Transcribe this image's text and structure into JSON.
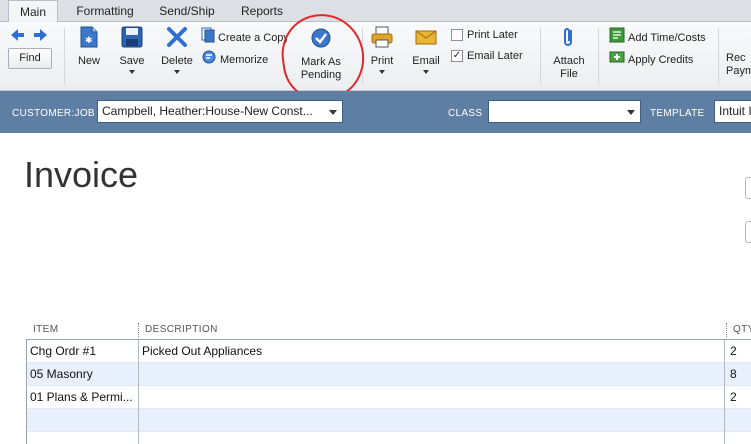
{
  "tabs": [
    "Main",
    "Formatting",
    "Send/Ship",
    "Reports"
  ],
  "toolbar": {
    "find": "Find",
    "new": "New",
    "save": "Save",
    "delete": "Delete",
    "create_copy": "Create a Copy",
    "memorize": "Memorize",
    "mark_as_pending": [
      "Mark As",
      "Pending"
    ],
    "print": "Print",
    "email": "Email",
    "print_later": "Print Later",
    "email_later": "Email Later",
    "print_later_checked": false,
    "email_later_checked": true,
    "attach_file": [
      "Attach",
      "File"
    ],
    "add_time_costs": "Add Time/Costs",
    "apply_credits": "Apply Credits",
    "receive_payments_partial": [
      "Rec",
      "Paym"
    ]
  },
  "customer_bar": {
    "customer_job_label": "CUSTOMER:JOB",
    "customer_job_value": "Campbell, Heather:House-New Const...",
    "class_label": "CLASS",
    "class_value": "",
    "template_label": "TEMPLATE",
    "template_value": "Intuit I"
  },
  "invoice": {
    "title": "Invoice"
  },
  "table": {
    "columns": [
      "ITEM",
      "DESCRIPTION",
      "QTY"
    ],
    "rows": [
      {
        "item": "Chg Ordr #1",
        "description": "Picked Out Appliances",
        "qty": "2"
      },
      {
        "item": "05 Masonry",
        "description": "",
        "qty": "8"
      },
      {
        "item": "01 Plans & Permi...",
        "description": "",
        "qty": "2"
      },
      {
        "item": "",
        "description": "",
        "qty": ""
      },
      {
        "item": "",
        "description": "",
        "qty": ""
      }
    ]
  },
  "colors": {
    "customer_bar": "#5e7fa3",
    "annotation": "#e02a2a",
    "row_alt": "#e8f0fb"
  },
  "icons": [
    "arrow-left-icon",
    "arrow-right-icon",
    "new-doc-icon",
    "save-icon",
    "delete-x-icon",
    "copy-icon",
    "memorize-icon",
    "check-circle-icon",
    "printer-icon",
    "envelope-icon",
    "paperclip-icon",
    "time-costs-icon",
    "credits-icon"
  ]
}
